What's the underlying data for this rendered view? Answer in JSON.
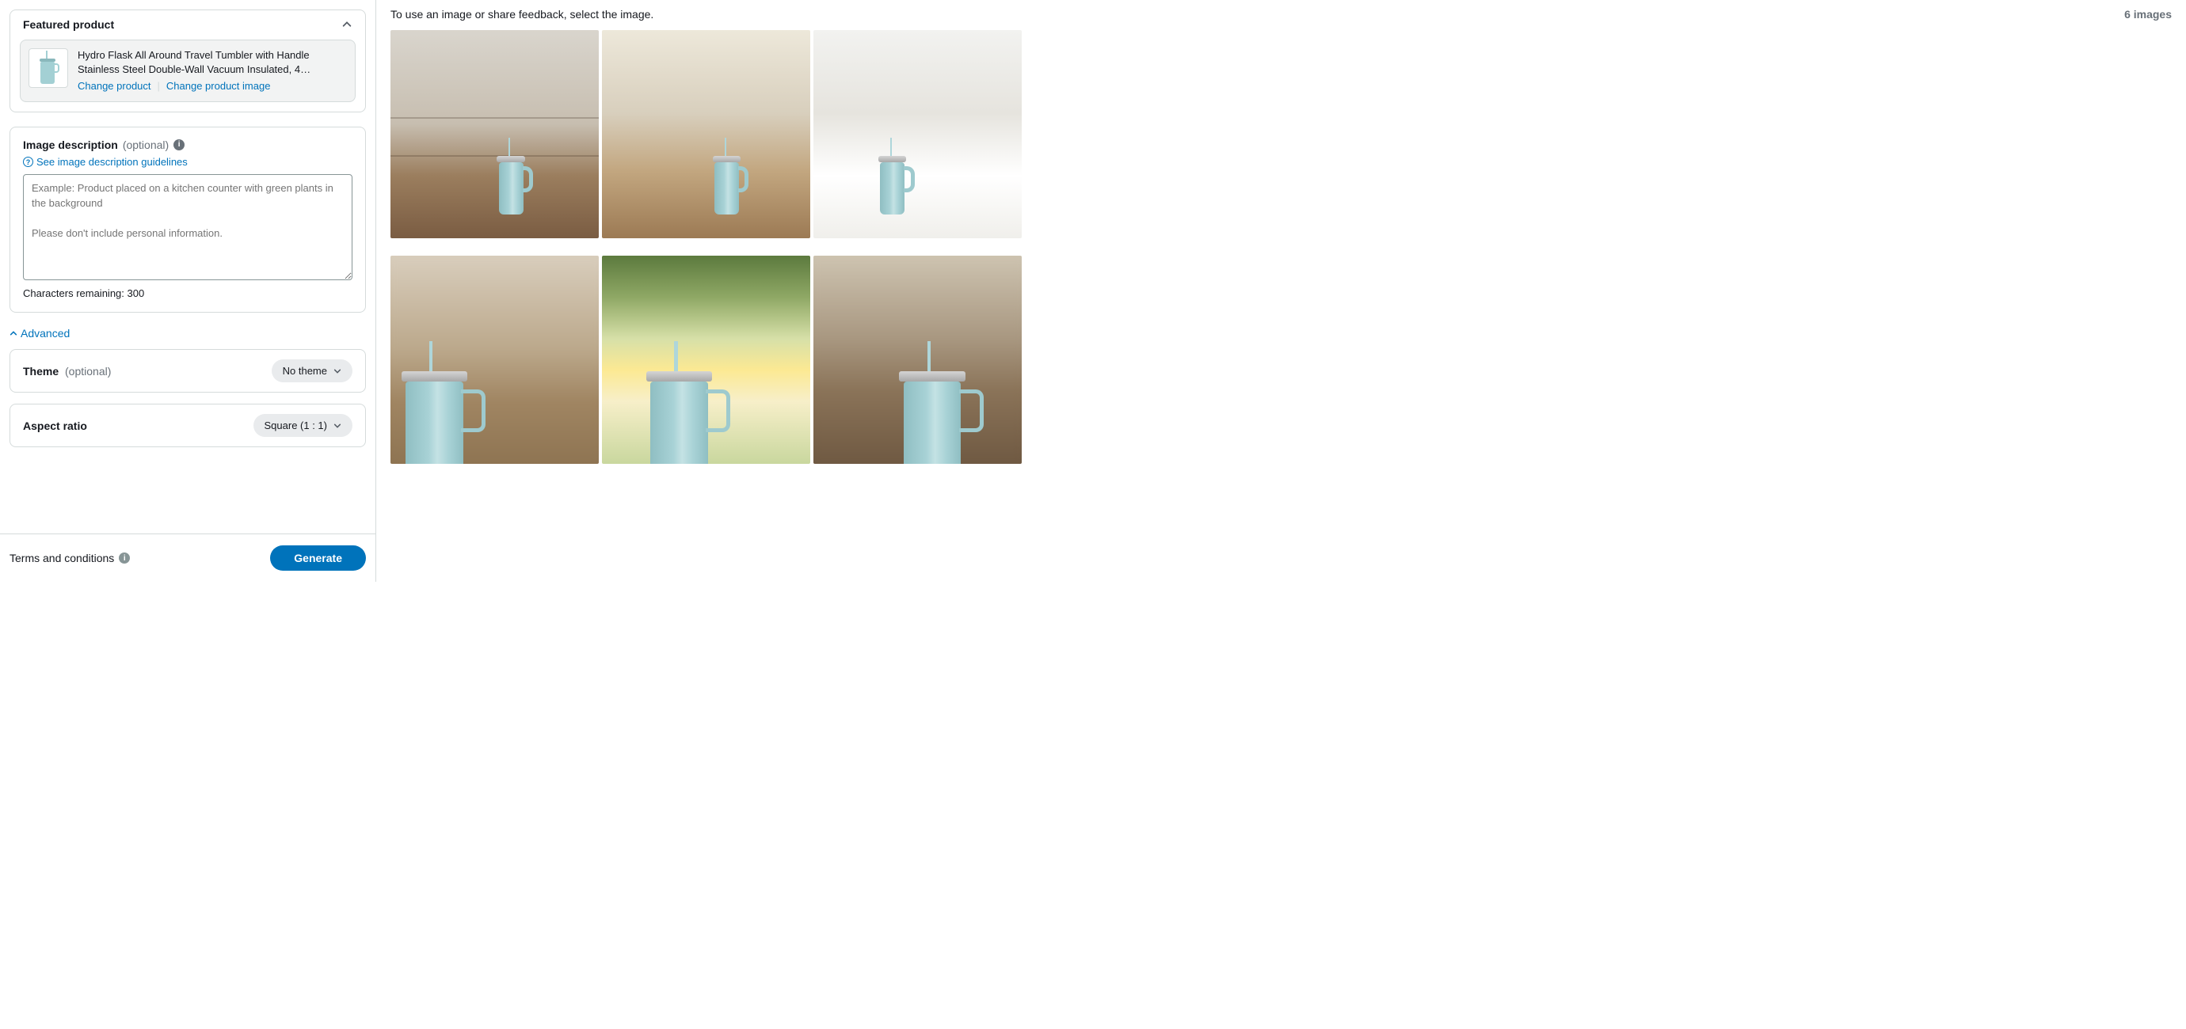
{
  "left": {
    "featured_header": "Featured product",
    "product_title": "Hydro Flask All Around Travel Tumbler with Handle Stainless Steel Double-Wall Vacuum Insulated, 4…",
    "change_product": "Change product",
    "change_product_image": "Change product image",
    "image_desc_label": "Image description",
    "optional": "(optional)",
    "guidelines_link": "See image description guidelines",
    "textarea_placeholder": "Example: Product placed on a kitchen counter with green plants in the background\n\nPlease don't include personal information.",
    "chars_remaining": "Characters remaining: 300",
    "advanced": "Advanced",
    "theme_label": "Theme",
    "theme_value": "No theme",
    "aspect_label": "Aspect ratio",
    "aspect_value": "Square (1 : 1)",
    "terms": "Terms and conditions",
    "generate": "Generate"
  },
  "right": {
    "instruction": "To use an image or share feedback, select the image.",
    "image_count": "6 images"
  }
}
